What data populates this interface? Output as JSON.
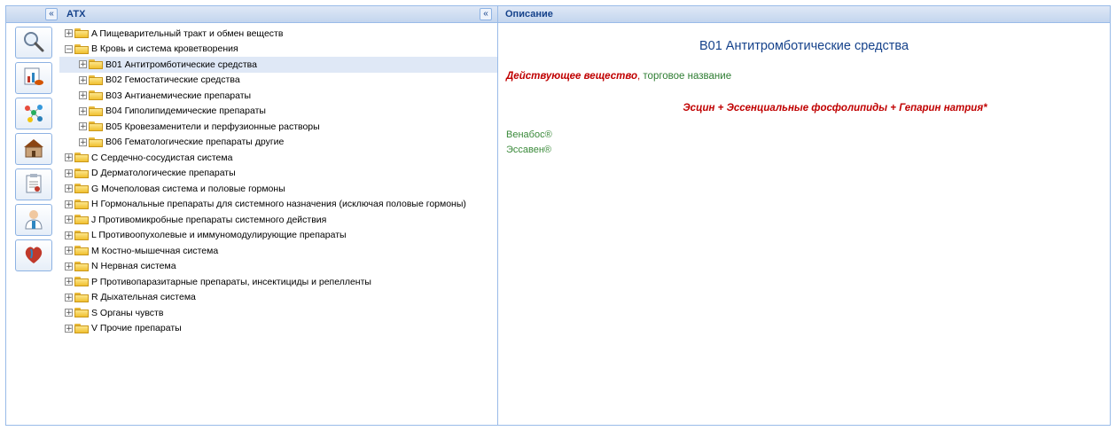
{
  "tree_panel": {
    "title": "АТХ",
    "collapse_glyph": "«"
  },
  "strip": {
    "collapse_glyph": "«",
    "tools": [
      {
        "name": "search-tool-button",
        "icon": "magnifier-icon"
      },
      {
        "name": "pharmacology-tool-button",
        "icon": "pills-chart-icon"
      },
      {
        "name": "molecule-tool-button",
        "icon": "molecule-icon"
      },
      {
        "name": "pharmacy-tool-button",
        "icon": "pharmacy-building-icon"
      },
      {
        "name": "document-tool-button",
        "icon": "clipboard-icon"
      },
      {
        "name": "doctor-tool-button",
        "icon": "doctor-icon"
      },
      {
        "name": "heart-tool-button",
        "icon": "heart-icon"
      }
    ]
  },
  "tree": [
    {
      "label": "A Пищеварительный тракт и обмен веществ",
      "level": 0,
      "expander": "+"
    },
    {
      "label": "B Кровь и система кроветворения",
      "level": 0,
      "expander": "−"
    },
    {
      "label": "B01 Антитромботические средства",
      "level": 1,
      "expander": "+",
      "selected": true
    },
    {
      "label": "B02 Гемостатические средства",
      "level": 1,
      "expander": "+"
    },
    {
      "label": "B03 Антианемические препараты",
      "level": 1,
      "expander": "+"
    },
    {
      "label": "B04 Гиполипидемические препараты",
      "level": 1,
      "expander": "+"
    },
    {
      "label": "B05 Кровезаменители и перфузионные растворы",
      "level": 1,
      "expander": "+"
    },
    {
      "label": "B06 Гематологические препараты другие",
      "level": 1,
      "expander": "+"
    },
    {
      "label": "C Сердечно-сосудистая система",
      "level": 0,
      "expander": "+"
    },
    {
      "label": "D Дерматологические препараты",
      "level": 0,
      "expander": "+"
    },
    {
      "label": "G Мочеполовая система и половые гормоны",
      "level": 0,
      "expander": "+"
    },
    {
      "label": "H Гормональные препараты для системного назначения (исключая половые гормоны)",
      "level": 0,
      "expander": "+"
    },
    {
      "label": "J Противомикробные препараты системного действия",
      "level": 0,
      "expander": "+"
    },
    {
      "label": "L Противоопухолевые и иммуномодулирующие препараты",
      "level": 0,
      "expander": "+"
    },
    {
      "label": "M Костно-мышечная система",
      "level": 0,
      "expander": "+"
    },
    {
      "label": "N Нервная система",
      "level": 0,
      "expander": "+"
    },
    {
      "label": "P Противопаразитарные препараты, инсектициды и репелленты",
      "level": 0,
      "expander": "+"
    },
    {
      "label": "R Дыхательная система",
      "level": 0,
      "expander": "+"
    },
    {
      "label": "S Органы чувств",
      "level": 0,
      "expander": "+"
    },
    {
      "label": "V Прочие препараты",
      "level": 0,
      "expander": "+"
    }
  ],
  "desc": {
    "panel_title": "Описание",
    "title": "B01 Антитромботические средства",
    "substance_label": "Действующее вещество",
    "separator": ",",
    "trade_label": " торговое название",
    "composition": "Эсцин + Эссенциальные фосфолипиды + Гепарин натрия*",
    "brands": [
      "Венабос®",
      "Эссавен®"
    ]
  },
  "colors": {
    "header_blue": "#15428b",
    "border": "#99bbe8",
    "selected_row": "#dfe8f6",
    "substance_red": "#c00000",
    "brand_green": "#3a8a3a"
  }
}
